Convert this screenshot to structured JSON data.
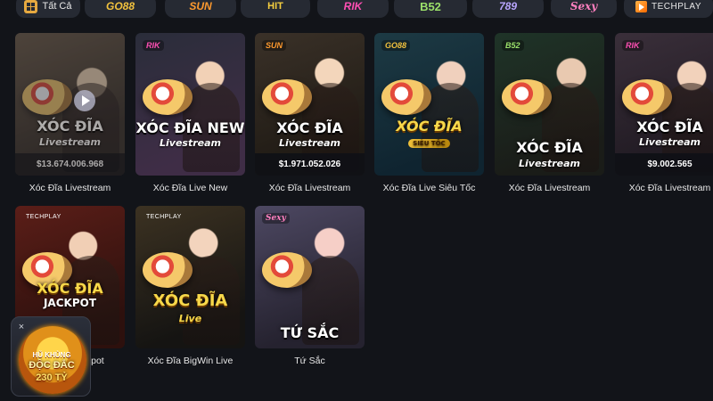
{
  "providers": [
    {
      "label": "Tất Cả",
      "icon": "grid-icon"
    },
    {
      "label": "GO88"
    },
    {
      "label": "SUN"
    },
    {
      "label": "HIT"
    },
    {
      "label": "RIK"
    },
    {
      "label": "B52"
    },
    {
      "label": "789"
    },
    {
      "label": "Sexy"
    },
    {
      "label": "TECHPLAY"
    }
  ],
  "games": [
    {
      "title": "Xóc Đĩa Livestream",
      "art_title": "XÓC ĐĨA",
      "art_sub": "Livestream",
      "amount": "$13.674.006.968",
      "provider_tag": ""
    },
    {
      "title": "Xóc Đĩa Live New",
      "art_title": "XÓC ĐĨA NEW",
      "art_sub": "Livestream",
      "amount": "",
      "provider_tag": "RIK"
    },
    {
      "title": "Xóc Đĩa Livestream",
      "art_title": "XÓC ĐĨA",
      "art_sub": "Livestream",
      "amount": "$1.971.052.026",
      "provider_tag": "SUN"
    },
    {
      "title": "Xóc Đĩa Live Siêu Tốc",
      "art_title": "XÓC ĐĨA",
      "art_sub": "SIÊU TỐC",
      "amount": "",
      "provider_tag": "GO88"
    },
    {
      "title": "Xóc Đĩa Livestream",
      "art_title": "XÓC ĐĨA",
      "art_sub": "Livestream",
      "amount": "",
      "provider_tag": "B52"
    },
    {
      "title": "Xóc Đĩa Livestream",
      "art_title": "XÓC ĐĨA",
      "art_sub": "Livestream",
      "amount": "$9.002.565",
      "provider_tag": "RIK"
    },
    {
      "title": "Xóc Đĩa Jackpot",
      "art_title": "XÓC ĐĨA",
      "art_sub": "JACKPOT",
      "amount": "",
      "provider_tag": "TECHPLAY"
    },
    {
      "title": "Xóc Đĩa BigWin Live",
      "art_title": "XÓC ĐĨA",
      "art_sub": "Live",
      "amount": "",
      "provider_tag": "TECHPLAY"
    },
    {
      "title": "Tứ Sắc",
      "art_title": "TỨ SẮC",
      "art_sub": "",
      "amount": "",
      "provider_tag": "Sexy"
    }
  ],
  "promo": {
    "line1": "HŨ KHỦNG",
    "line2": "ĐỘC ĐẮC",
    "line3": "230 TỶ",
    "close_label": "×"
  },
  "colors": {
    "background": "#121419",
    "card_label": "#e6e6e6",
    "accent_gold": "#f7d84a"
  }
}
